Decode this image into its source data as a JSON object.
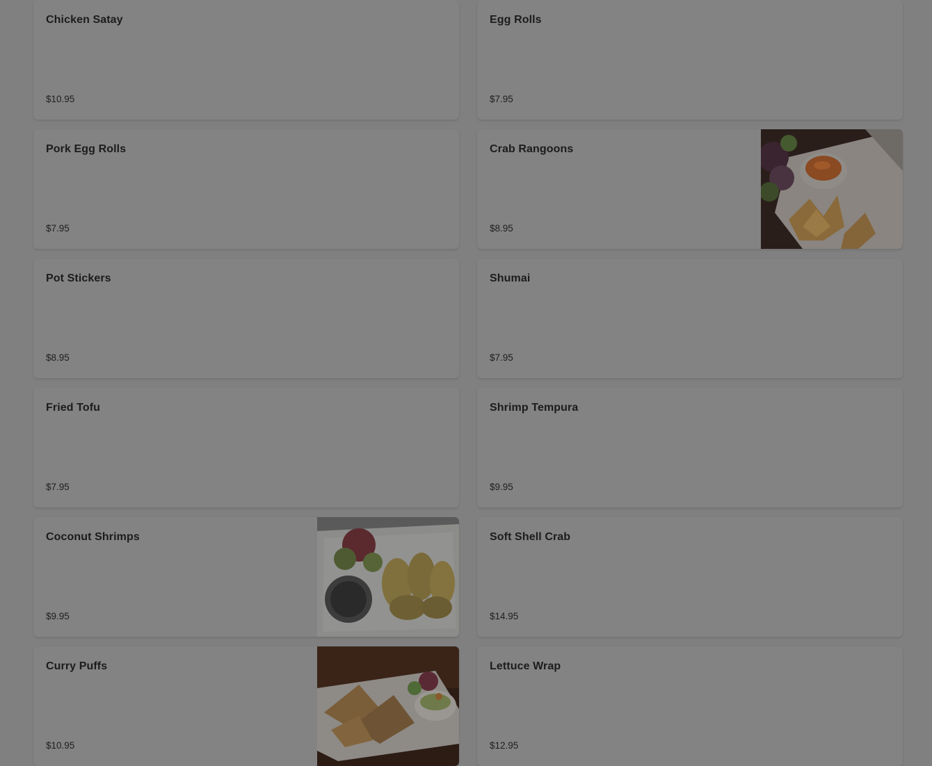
{
  "menu": {
    "items": [
      {
        "name": "Chicken Satay",
        "price": "$10.95"
      },
      {
        "name": "Egg Rolls",
        "price": "$7.95"
      },
      {
        "name": "Pork Egg Rolls",
        "price": "$7.95"
      },
      {
        "name": "Crab Rangoons",
        "price": "$8.95"
      },
      {
        "name": "Pot Stickers",
        "price": "$8.95"
      },
      {
        "name": "Shumai",
        "price": "$7.95"
      },
      {
        "name": "Fried Tofu",
        "price": "$7.95"
      },
      {
        "name": "Shrimp Tempura",
        "price": "$9.95"
      },
      {
        "name": "Coconut Shrimps",
        "price": "$9.95"
      },
      {
        "name": "Soft Shell Crab",
        "price": "$14.95"
      },
      {
        "name": "Curry Puffs",
        "price": "$10.95"
      },
      {
        "name": "Lettuce Wrap",
        "price": "$12.95"
      }
    ]
  },
  "colors": {
    "overlay_bg": "#808080",
    "card_bg": "#838383",
    "text": "#1c1c1c"
  }
}
